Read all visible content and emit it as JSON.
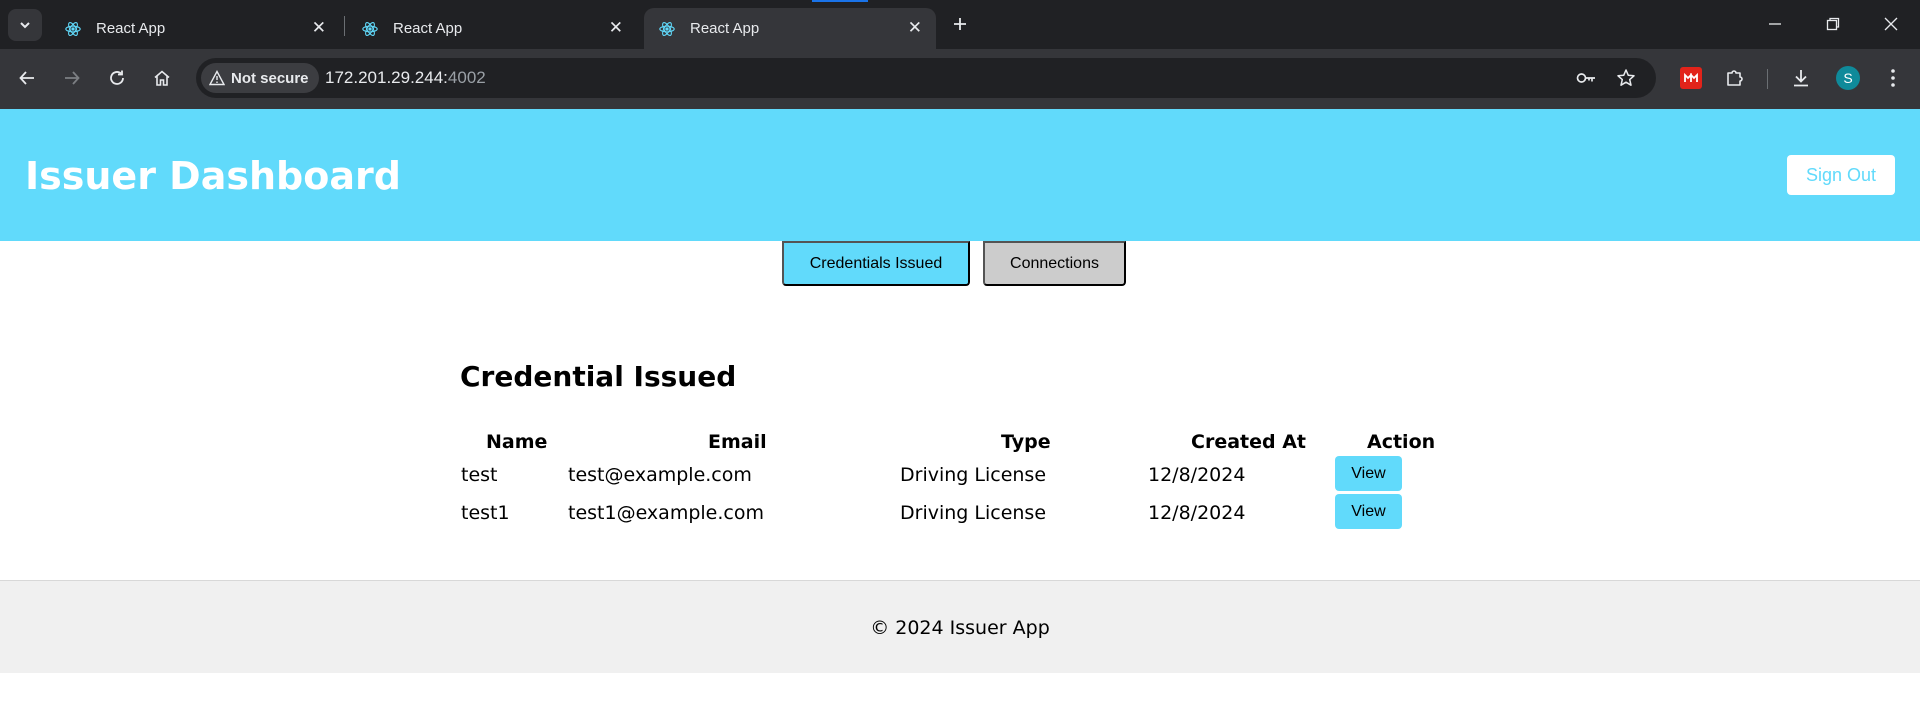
{
  "browser": {
    "tabs": [
      {
        "title": "React App",
        "icon": "react-icon",
        "active": false
      },
      {
        "title": "React App",
        "icon": "react-icon",
        "active": false
      },
      {
        "title": "React App",
        "icon": "react-icon",
        "active": true
      }
    ],
    "close_glyph": "✕",
    "new_tab_glyph": "+",
    "security_label": "Not secure",
    "url_host": "172.201.29.244:",
    "url_port": "4002",
    "profile_initial": "S"
  },
  "header": {
    "title": "Issuer Dashboard",
    "sign_out_label": "Sign Out"
  },
  "nav": {
    "tabs": [
      {
        "label": "Credentials Issued",
        "active": true
      },
      {
        "label": "Connections",
        "active": false
      }
    ]
  },
  "main": {
    "section_title": "Credential Issued",
    "table": {
      "columns": [
        "Name",
        "Email",
        "Type",
        "Created At",
        "Action"
      ],
      "rows": [
        {
          "name": "test",
          "email": "test@example.com",
          "type": "Driving License",
          "created_at": "12/8/2024",
          "action": "View"
        },
        {
          "name": "test1",
          "email": "test1@example.com",
          "type": "Driving License",
          "created_at": "12/8/2024",
          "action": "View"
        }
      ]
    }
  },
  "footer": {
    "text": "© 2024 Issuer App"
  },
  "colors": {
    "accent": "#61dafb",
    "inactive_tab": "#cccccc",
    "footer_bg": "#f0f0f0"
  }
}
